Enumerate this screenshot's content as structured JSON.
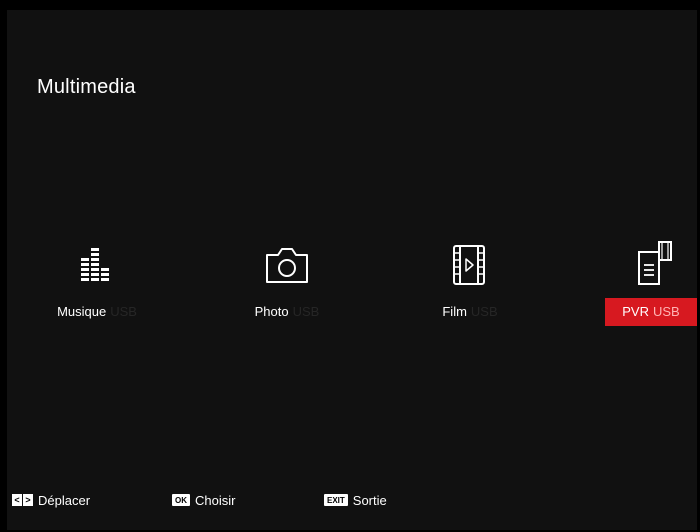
{
  "title": "Multimedia",
  "tiles": [
    {
      "label": "Musique",
      "source": "USB",
      "icon": "equalizer-icon",
      "selected": false
    },
    {
      "label": "Photo",
      "source": "USB",
      "icon": "camera-icon",
      "selected": false
    },
    {
      "label": "Film",
      "source": "USB",
      "icon": "film-icon",
      "selected": false
    },
    {
      "label": "PVR",
      "source": "USB",
      "icon": "recording-icon",
      "selected": true
    }
  ],
  "footer": {
    "move_key_left": "<",
    "move_key_right": ">",
    "move_label": "Déplacer",
    "ok_key": "OK",
    "ok_label": "Choisir",
    "exit_key": "EXIT",
    "exit_label": "Sortie"
  },
  "colors": {
    "background": "#111111",
    "selected": "#d71920",
    "source_text": "#262626"
  }
}
